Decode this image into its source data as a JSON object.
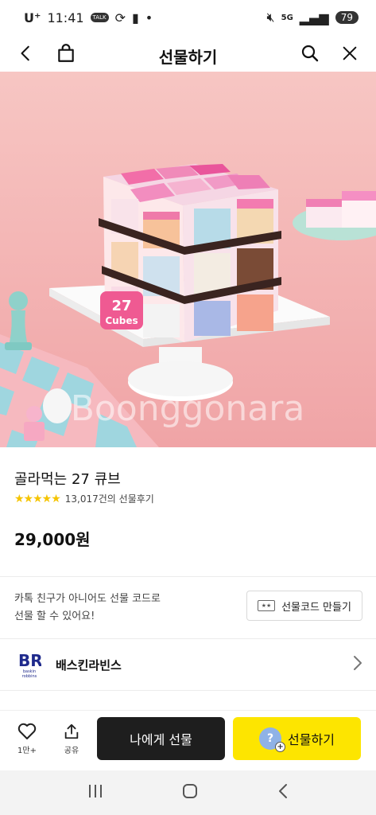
{
  "status": {
    "carrier": "U⁺",
    "time": "11:41",
    "badge": "TALK",
    "network": "5G",
    "battery": "79"
  },
  "header": {
    "title": "선물하기"
  },
  "hero": {
    "watermark": "Boonggonara",
    "box_label_line1": "27",
    "box_label_line2": "Cubes"
  },
  "product": {
    "title": "골라먹는 27 큐브",
    "stars": "★★★★★",
    "review_count": "13,017건의 선물후기",
    "price": "29,000원"
  },
  "promo": {
    "line1": "카톡 친구가 아니어도 선물 코드로",
    "line2": "선물 할 수 있어요!",
    "button_label": "선물코드 만들기",
    "button_icon_text": "★★"
  },
  "brand": {
    "logo_text": "BR",
    "logo_sub": "baskin robbins",
    "name": "배스킨라빈스"
  },
  "actions": {
    "like_count": "1만+",
    "share_label": "공유",
    "self_gift_label": "나에게 선물",
    "gift_label": "선물하기",
    "gift_icon_text": "?",
    "gift_icon_plus": "+"
  },
  "colors": {
    "accent_yellow": "#fde500",
    "dark_button": "#1e1e1e",
    "star_yellow": "#f5c400",
    "brand_pink": "#e5007e",
    "brand_blue": "#1f2a8c"
  }
}
